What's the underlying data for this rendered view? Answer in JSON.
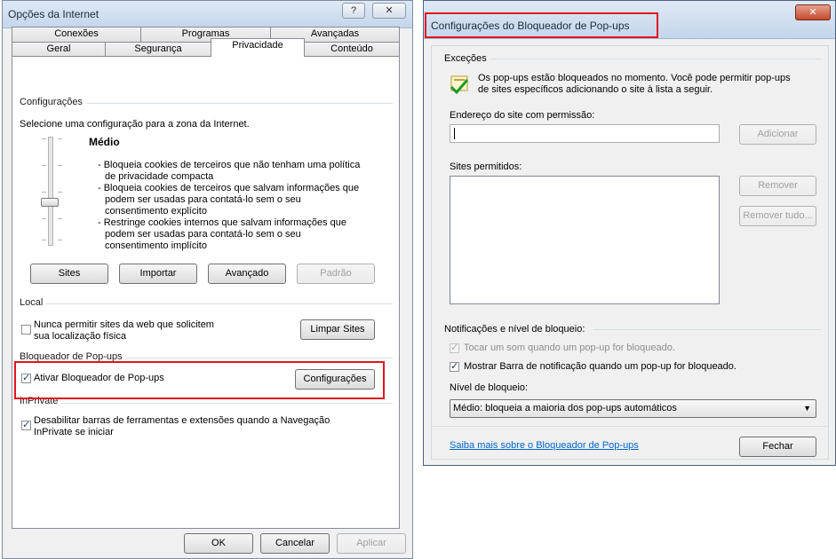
{
  "internet_options": {
    "title": "Opções da Internet",
    "help_icon": "question-icon",
    "close_icon": "close-icon",
    "tabs_row1": [
      "Conexões",
      "Programas",
      "Avançadas"
    ],
    "tabs_row2": [
      "Geral",
      "Segurança",
      "Privacidade",
      "Conteúdo"
    ],
    "active_tab": "Privacidade",
    "settings": {
      "group_label": "Configurações",
      "instruction": "Selecione uma configuração para a zona da Internet.",
      "level": "Médio",
      "slider_level_fraction": 0.5,
      "desc_lines": [
        "- Bloqueia cookies de terceiros que não tenham uma política",
        "de privacidade compacta",
        "- Bloqueia cookies de terceiros que salvam informações que",
        "podem ser usadas para contatá-lo sem o seu",
        "consentimento explícito",
        "- Restringe cookies internos que salvam informações que",
        "podem ser usadas para contatá-lo sem o seu",
        "consentimento implícito"
      ],
      "buttons": {
        "sites": "Sites",
        "import": "Importar",
        "advanced": "Avançado",
        "default": "Padrão"
      }
    },
    "local": {
      "group_label": "Local",
      "checkbox_line1": "Nunca permitir sites da web que solicitem",
      "checkbox_line2": "sua localização física",
      "checked": false,
      "clear_button": "Limpar Sites"
    },
    "popup": {
      "group_label": "Bloqueador de Pop-ups",
      "checkbox_label": "Ativar Bloqueador de Pop-ups",
      "checked": true,
      "settings_button": "Configurações"
    },
    "inprivate": {
      "group_label": "InPrivate",
      "checkbox_line1": "Desabilitar barras de ferramentas e extensões quando a Navegação",
      "checkbox_line2": "InPrivate se iniciar",
      "checked": true
    },
    "footer": {
      "ok": "OK",
      "cancel": "Cancelar",
      "apply": "Aplicar"
    }
  },
  "popup_settings": {
    "title": "Configurações do Bloqueador de Pop-ups",
    "close_icon": "close-icon",
    "exceptions": {
      "group_label": "Exceções",
      "info_line1": "Os pop-ups estão bloqueados no momento. Você pode permitir pop-ups",
      "info_line2": "de sites específicos adicionando o site à lista a seguir.",
      "address_label": "Endereço do site com permissão:",
      "address_value": "",
      "add_button": "Adicionar",
      "allowed_label": "Sites permitidos:",
      "allowed_sites": [],
      "remove_button": "Remover",
      "remove_all_button": "Remover tudo..."
    },
    "notifications": {
      "group_label": "Notificações e nível de bloqueio:",
      "sound_label": "Tocar um som quando um pop-up for bloqueado.",
      "sound_checked": true,
      "bar_label": "Mostrar Barra de notificação quando um pop-up for bloqueado.",
      "bar_checked": true,
      "level_label": "Nível de bloqueio:",
      "level_value": "Médio: bloqueia a maioria dos pop-ups automáticos"
    },
    "learn_more_link": "Saiba mais sobre o Bloqueador de Pop-ups",
    "close_button": "Fechar"
  },
  "colors": {
    "highlight_red": "#e0141e",
    "link_blue": "#0066cc"
  }
}
